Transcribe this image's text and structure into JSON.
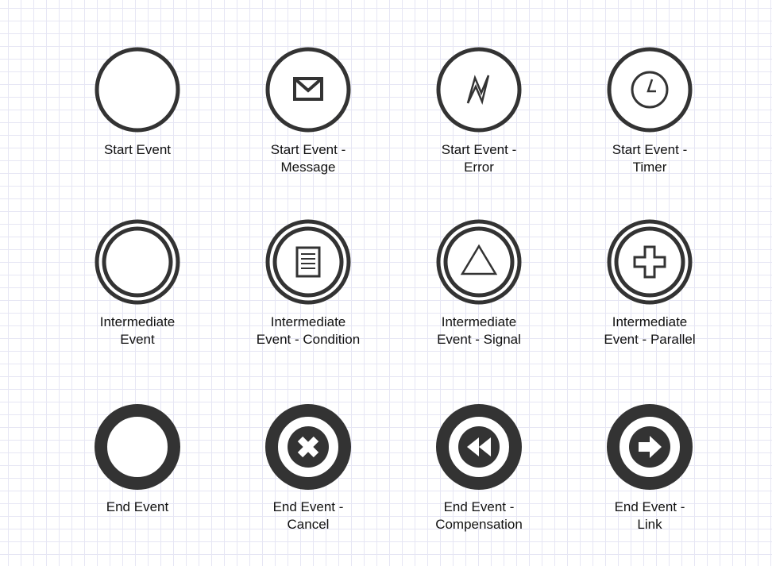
{
  "diagram": {
    "colors": {
      "stroke": "#333333",
      "fill": "#ffffff",
      "grid": "#e6e6f4"
    },
    "events": [
      {
        "label": "Start Event",
        "kind": "start",
        "marker": "none"
      },
      {
        "label": "Start Event -\nMessage",
        "kind": "start",
        "marker": "envelope-icon"
      },
      {
        "label": "Start Event -\nError",
        "kind": "start",
        "marker": "lightning-icon"
      },
      {
        "label": "Start Event -\nTimer",
        "kind": "start",
        "marker": "clock-icon"
      },
      {
        "label": "Intermediate\nEvent",
        "kind": "intermediate",
        "marker": "none"
      },
      {
        "label": "Intermediate\nEvent - Condition",
        "kind": "intermediate",
        "marker": "document-lines-icon"
      },
      {
        "label": "Intermediate\nEvent - Signal",
        "kind": "intermediate",
        "marker": "triangle-icon"
      },
      {
        "label": "Intermediate\nEvent - Parallel",
        "kind": "intermediate",
        "marker": "plus-icon"
      },
      {
        "label": "End Event",
        "kind": "end",
        "marker": "none"
      },
      {
        "label": "End Event -\nCancel",
        "kind": "end",
        "marker": "x-icon"
      },
      {
        "label": "End Event -\nCompensation",
        "kind": "end",
        "marker": "rewind-icon"
      },
      {
        "label": "End Event -\nLink",
        "kind": "end",
        "marker": "arrow-right-icon"
      }
    ]
  }
}
